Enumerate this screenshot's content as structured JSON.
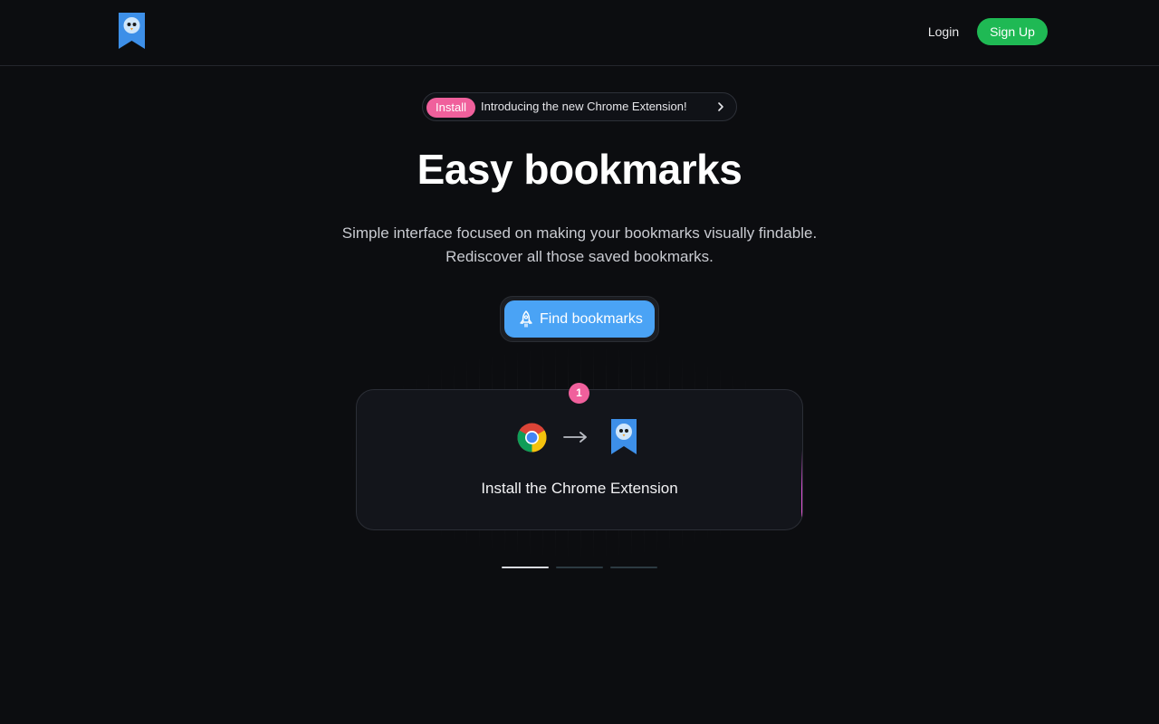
{
  "header": {
    "logo_icon": "bookmark-bird-logo-icon",
    "login_label": "Login",
    "signup_label": "Sign Up",
    "signup_color": "#1fb954"
  },
  "announcement": {
    "badge_label": "Install",
    "badge_color": "#f0609c",
    "text": "Introducing the new Chrome Extension!",
    "chevron_icon": "chevron-right-icon"
  },
  "hero": {
    "title": "Easy bookmarks",
    "subtitle_line1": "Simple interface focused on making your bookmarks visually findable.",
    "subtitle_line2": "Rediscover all those saved bookmarks."
  },
  "cta": {
    "label": "Find bookmarks",
    "icon": "rocket-icon",
    "color": "#4aa3f5"
  },
  "steps": {
    "current_step_number": "1",
    "current_step_label": "Install the Chrome Extension",
    "icons": [
      "chrome-icon",
      "arrow-right-icon",
      "bookmark-bird-logo-icon"
    ],
    "total_steps": 3,
    "active_index": 0
  }
}
